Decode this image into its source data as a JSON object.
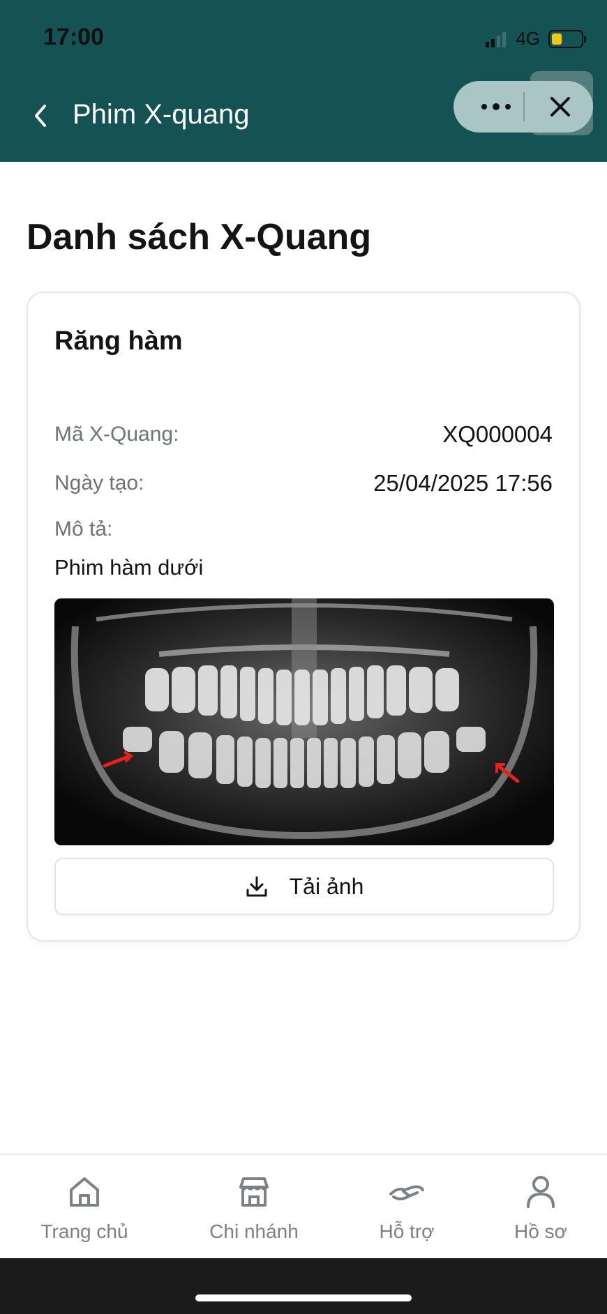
{
  "status_bar": {
    "time": "17:00",
    "network": "4G",
    "battery_color": "#f3c613"
  },
  "header": {
    "title": "Phim X-quang",
    "background": "#155254",
    "back_icon": "chevron-left-icon",
    "more_icon": "more-dots-icon",
    "close_icon": "close-icon"
  },
  "page": {
    "title": "Danh sách X-Quang"
  },
  "card": {
    "title": "Răng hàm",
    "code_label": "Mã X-Quang:",
    "code_value": "XQ000004",
    "date_label": "Ngày tạo:",
    "date_value": "25/04/2025 17:56",
    "desc_label": "Mô tả:",
    "desc_value": "Phim hàm dưới",
    "image_alt": "panoramic-dental-xray",
    "download_label": "Tải ảnh",
    "download_icon": "download-icon"
  },
  "bottom_nav": {
    "items": [
      {
        "label": "Trang chủ",
        "icon": "home-icon"
      },
      {
        "label": "Chi nhánh",
        "icon": "store-icon"
      },
      {
        "label": "Hỗ trợ",
        "icon": "handshake-icon"
      },
      {
        "label": "Hồ sơ",
        "icon": "user-icon"
      }
    ]
  }
}
